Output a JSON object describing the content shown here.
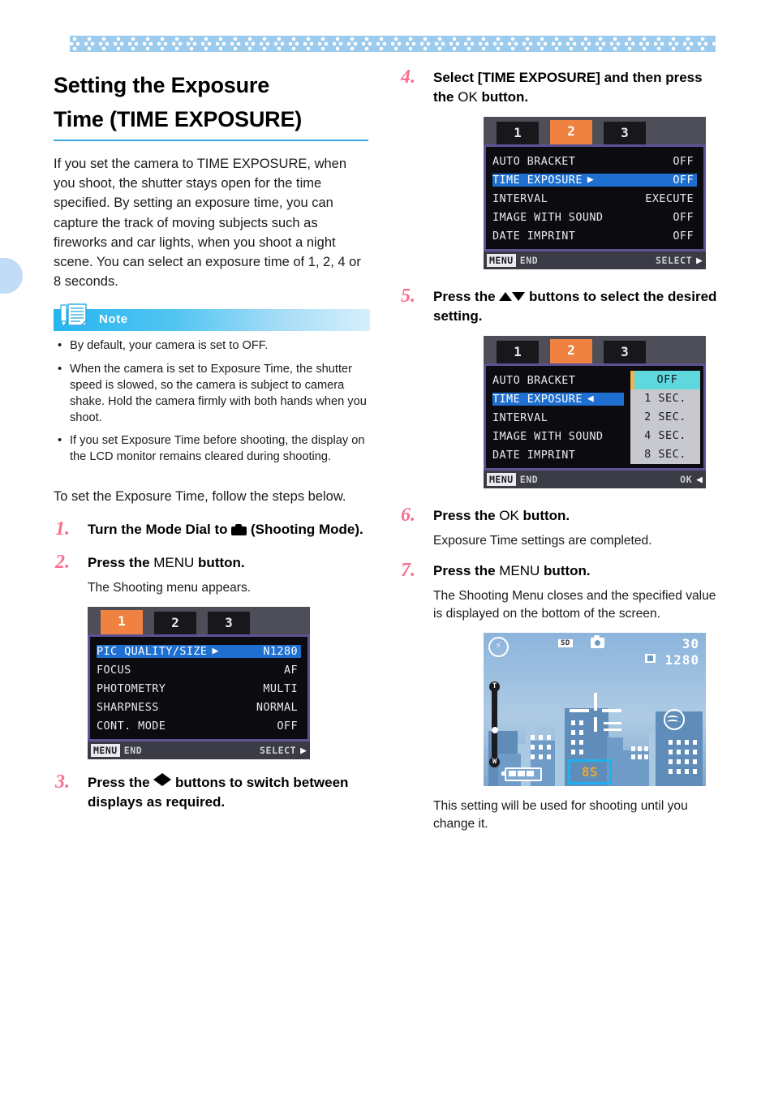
{
  "decor": {
    "band": "diamond-pattern-band",
    "band_color": "#9ccbee",
    "tab_color": "#c3dcf6"
  },
  "heading": {
    "line1": "Setting the Exposure",
    "line2": "Time (TIME EXPOSURE)",
    "rule_color": "#3aa7e0"
  },
  "intro": "If you set the camera to TIME EXPOSURE, when you shoot, the shutter stays open for the time specified. By setting an exposure time,  you can capture the track of moving subjects such as fireworks and car lights, when you shoot a night scene. You can select an exposure time of 1, 2, 4 or 8 seconds.",
  "note": {
    "title": "Note",
    "icon": "note-pencil-paper-icon",
    "items": [
      "By default, your camera is set to OFF.",
      "When the camera is set to Exposure Time, the shutter speed is slowed, so the camera is subject to camera shake. Hold the camera firmly with both hands when you shoot.",
      "If you set Exposure Time before shooting, the display on the LCD monitor remains cleared during shooting."
    ]
  },
  "lead": "To set the Exposure Time, follow the steps below.",
  "steps": [
    {
      "num": "1.",
      "head_a": "Turn the Mode Dial to ",
      "head_icon": "camera-icon",
      "head_b": " (Shooting Mode).",
      "sub": ""
    },
    {
      "num": "2.",
      "head_a": "Press the ",
      "head_key": "MENU",
      "head_b": " button.",
      "sub": "The Shooting menu appears."
    },
    {
      "num": "3.",
      "head_a": "Press the ",
      "head_icon": "left-right-arrows-icon",
      "head_b": " buttons to switch between displays as required.",
      "sub": ""
    },
    {
      "num": "4.",
      "head_a": "Select  [TIME EXPOSURE] and then press the ",
      "head_key": "OK",
      "head_b": " button.",
      "sub": ""
    },
    {
      "num": "5.",
      "head_a": "Press the ",
      "head_icon": "up-down-arrows-icon",
      "head_b": " buttons to select the desired setting.",
      "sub": ""
    },
    {
      "num": "6.",
      "head_a": "Press the ",
      "head_key": "OK",
      "head_b": " button.",
      "sub": "Exposure Time settings are completed."
    },
    {
      "num": "7.",
      "head_a": "Press the ",
      "head_key": "MENU",
      "head_b": " button.",
      "sub": "The Shooting Menu closes and the specified value is displayed on the bottom of the screen."
    }
  ],
  "closing": "This setting will be used for shooting until you change it.",
  "screens": {
    "menu1": {
      "tabs": [
        "1",
        "2",
        "3"
      ],
      "active_tab": "1",
      "rows": [
        {
          "label": "PIC QUALITY/SIZE",
          "value": "N1280",
          "selected": true,
          "arrow": "▶"
        },
        {
          "label": "FOCUS",
          "value": "AF",
          "selected": false,
          "arrow": ""
        },
        {
          "label": "PHOTOMETRY",
          "value": "MULTI",
          "selected": false,
          "arrow": ""
        },
        {
          "label": "SHARPNESS",
          "value": "NORMAL",
          "selected": false,
          "arrow": ""
        },
        {
          "label": "CONT. MODE",
          "value": "OFF",
          "selected": false,
          "arrow": ""
        }
      ],
      "footer_left_chip": "MENU",
      "footer_left_text": "END",
      "footer_right_text": "SELECT"
    },
    "menu2": {
      "tabs": [
        "1",
        "2",
        "3"
      ],
      "active_tab": "2",
      "rows": [
        {
          "label": "AUTO BRACKET",
          "value": "OFF",
          "selected": false,
          "arrow": ""
        },
        {
          "label": "TIME EXPOSURE",
          "value": "OFF",
          "selected": true,
          "arrow": "▶"
        },
        {
          "label": "INTERVAL",
          "value": "EXECUTE",
          "selected": false,
          "arrow": ""
        },
        {
          "label": "IMAGE WITH SOUND",
          "value": "OFF",
          "selected": false,
          "arrow": ""
        },
        {
          "label": "DATE IMPRINT",
          "value": "OFF",
          "selected": false,
          "arrow": ""
        }
      ],
      "footer_left_chip": "MENU",
      "footer_left_text": "END",
      "footer_right_text": "SELECT"
    },
    "menu3": {
      "tabs": [
        "1",
        "2",
        "3"
      ],
      "active_tab": "2",
      "rows": [
        {
          "label": "AUTO BRACKET",
          "selected": false,
          "arrow": ""
        },
        {
          "label": "TIME EXPOSURE",
          "selected": true,
          "arrow": "◀"
        },
        {
          "label": "INTERVAL",
          "selected": false,
          "arrow": ""
        },
        {
          "label": "IMAGE WITH SOUND",
          "selected": false,
          "arrow": ""
        },
        {
          "label": "DATE IMPRINT",
          "selected": false,
          "arrow": ""
        }
      ],
      "popup_options": [
        "OFF",
        "1 SEC.",
        "2 SEC.",
        "4 SEC.",
        "8 SEC."
      ],
      "popup_selected": "OFF",
      "footer_left_chip": "MENU",
      "footer_left_text": "END",
      "footer_right_text": "OK"
    },
    "liveview": {
      "flash_icon": "flash-off-icon",
      "sd_badge": "SD",
      "camera_icon": "still-camera-icon",
      "shots_remaining": "30",
      "resolution": "1280",
      "resolution_icon": "fine-quality-icon",
      "zoom_top": "T",
      "zoom_bottom": "W",
      "battery_icon": "battery-full-icon",
      "scene_icon": "scene-mode-icon",
      "exposure_badge": "8S",
      "exposure_badge_color": "#f5a623",
      "exposure_box_color": "#1fb0ef"
    }
  }
}
